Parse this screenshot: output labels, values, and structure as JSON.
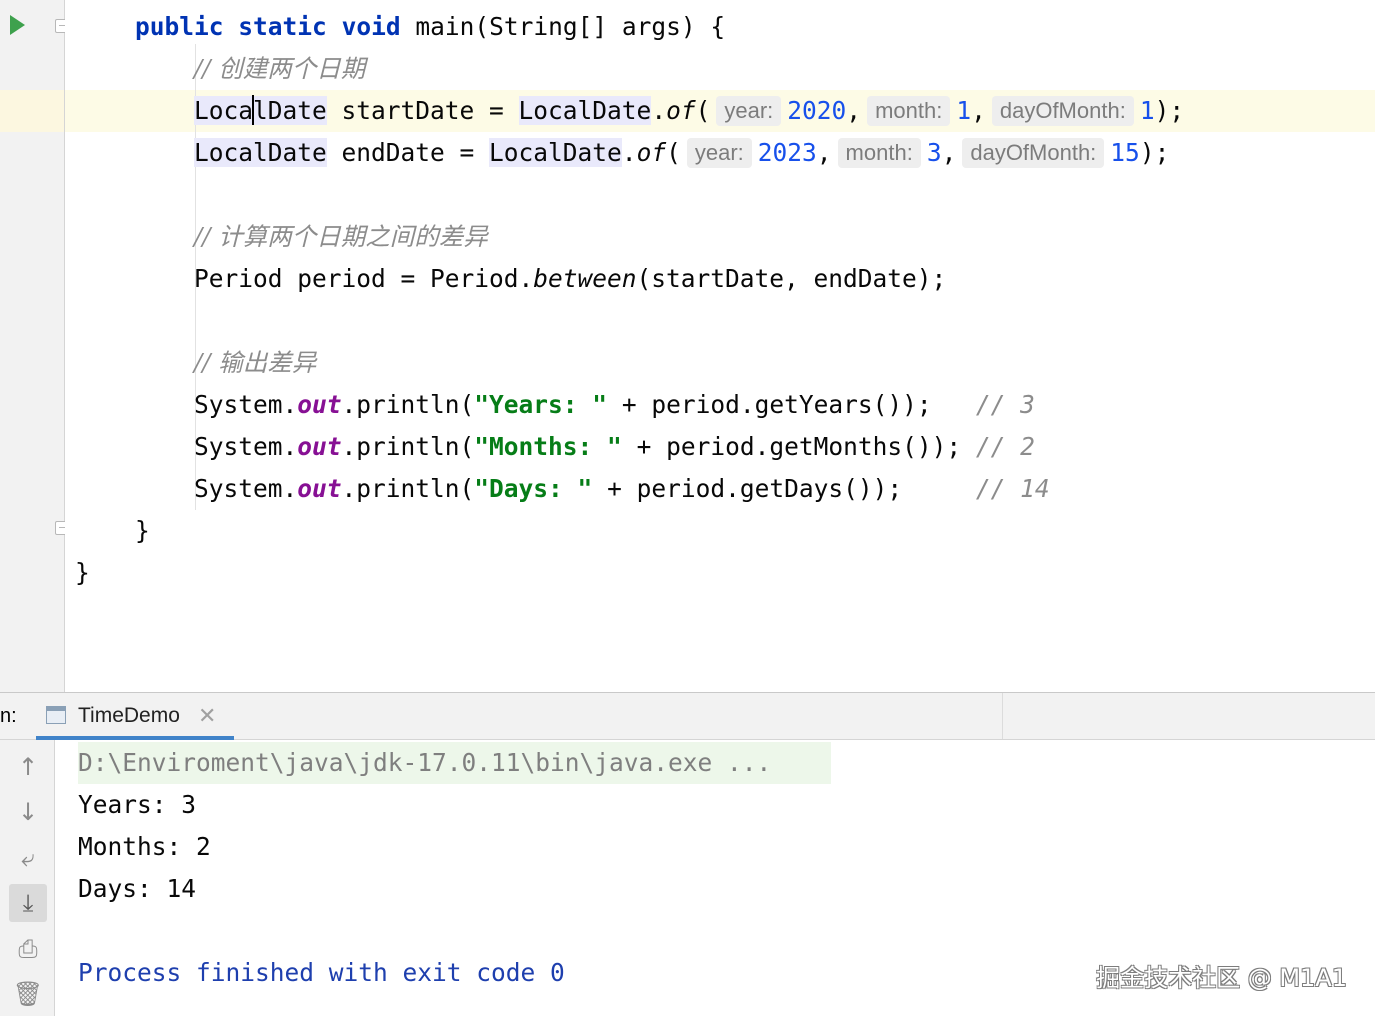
{
  "editor": {
    "lines": {
      "main_sig": [
        "public",
        " ",
        "static",
        " ",
        "void",
        " main(String[] args) {"
      ],
      "c1": "// 创建两个日期",
      "start": {
        "type": "LocalDate",
        "var": " startDate = ",
        "cls": "LocalDate",
        "dot": ".",
        "method": "of",
        "paren": "(",
        "hint1": "year:",
        "v1": "2020",
        "comma1": ",",
        "hint2": "month:",
        "v2": "1",
        "comma2": ",",
        "hint3": "dayOfMonth:",
        "v3": "1",
        "end": ");"
      },
      "end": {
        "type": "LocalDate",
        "var": " endDate = ",
        "cls": "LocalDate",
        "dot": ".",
        "method": "of",
        "paren": "(",
        "hint1": "year:",
        "v1": "2023",
        "comma1": ",",
        "hint2": "month:",
        "v2": "3",
        "comma2": ",",
        "hint3": "dayOfMonth:",
        "v3": "15",
        "end": ");"
      },
      "c2": "// 计算两个日期之间的差异",
      "period": {
        "pre": "Period period = Period.",
        "method": "between",
        "post": "(startDate, endDate);"
      },
      "c3": "// 输出差异",
      "println": [
        {
          "sys": "System.",
          "out": "out",
          "mid": ".println(",
          "str": "\"Years: \"",
          "rest": " + period.getYears());",
          "pad": "   ",
          "cmt": "// 3"
        },
        {
          "sys": "System.",
          "out": "out",
          "mid": ".println(",
          "str": "\"Months: \"",
          "rest": " + period.getMonths());",
          "pad": " ",
          "cmt": "// 2"
        },
        {
          "sys": "System.",
          "out": "out",
          "mid": ".println(",
          "str": "\"Days: \"",
          "rest": " + period.getDays());",
          "pad": "     ",
          "cmt": "// 14"
        }
      ],
      "close_method": "}",
      "close_class": "}"
    }
  },
  "run_panel": {
    "prefix": "n:",
    "tab_label": "TimeDemo",
    "tab_close": "✕",
    "tools": [
      "↑",
      "↓",
      "⤶",
      "⤓",
      "⎙",
      "🗑"
    ],
    "console": {
      "command": "D:\\Enviroment\\java\\jdk-17.0.11\\bin\\java.exe ...",
      "out1": "Years: 3",
      "out2": "Months: 2",
      "out3": "Days: 14",
      "finish": "Process finished with exit code 0"
    }
  },
  "watermark": "掘金技术社区 @ M1A1",
  "colors": {
    "keyword": "#0033b3",
    "string": "#067d17",
    "number": "#1750eb",
    "comment": "#8c8c8c",
    "field": "#871094",
    "line_highlight": "#fdfbe6"
  }
}
